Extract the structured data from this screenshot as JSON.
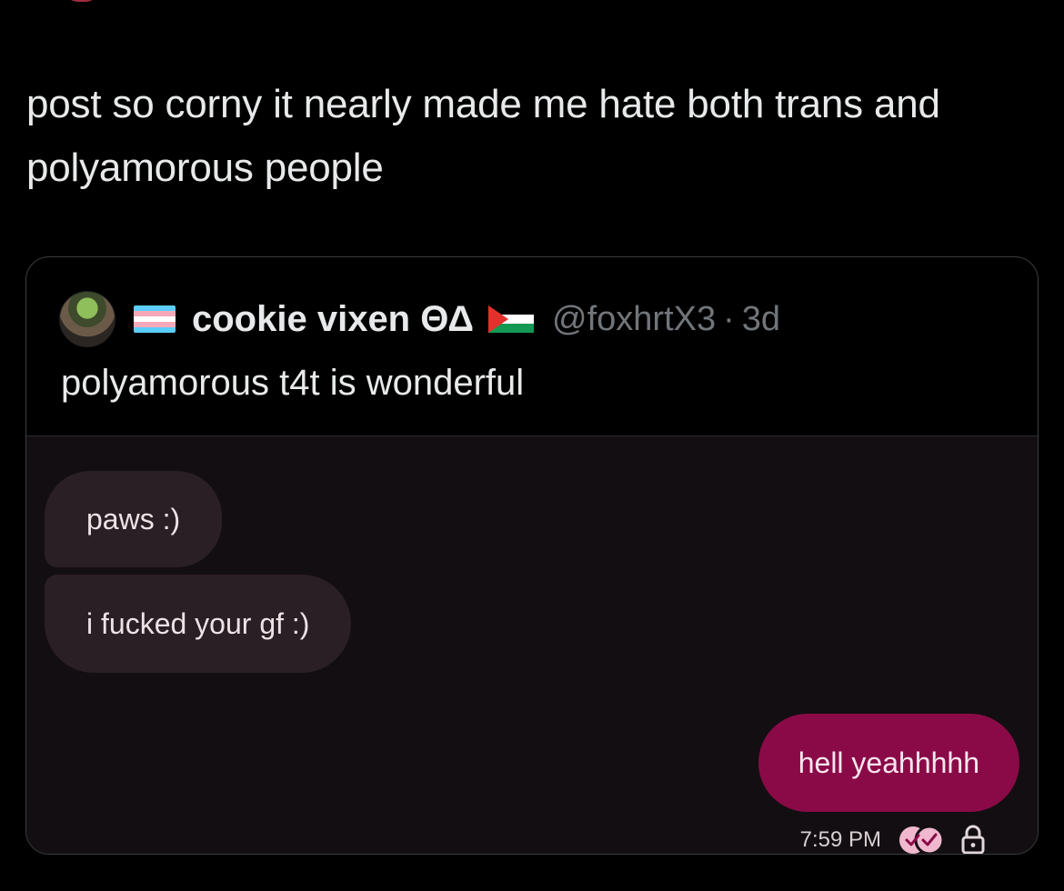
{
  "post": {
    "text": "post so corny it nearly made me hate both trans and polyamorous people"
  },
  "quote": {
    "display_name": "cookie vixen ΘΔ",
    "handle": "@foxhrtX3",
    "separator": "·",
    "time_ago": "3d",
    "text": "polyamorous t4t is wonderful",
    "avatar_icon": "user-avatar",
    "name_prefix_icon": "trans-flag-icon",
    "name_suffix_icon": "palestine-flag-icon"
  },
  "chat": {
    "incoming": [
      {
        "text": "paws :)"
      },
      {
        "text": "i fucked your gf :)"
      }
    ],
    "outgoing": [
      {
        "text": "hell yeahhhhh"
      }
    ],
    "timestamp": "7:59 PM",
    "status_icon": "read-receipt-icon",
    "lock_icon": "lock-icon"
  },
  "colors": {
    "background": "#000000",
    "text_primary": "#e7e9ea",
    "text_secondary": "#71767b",
    "incoming_bubble": "#2a1f24",
    "outgoing_bubble": "#8a0a48",
    "chat_background": "#130e11",
    "card_border": "#3a3d40"
  }
}
